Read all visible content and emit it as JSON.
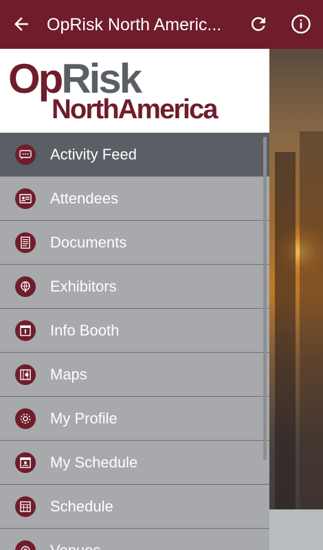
{
  "appbar": {
    "title": "OpRisk North Americ..."
  },
  "logo": {
    "op": "Op",
    "risk": "Risk",
    "line2": "NorthAmerica"
  },
  "menu": [
    {
      "label": "Activity Feed",
      "icon": "chat-bubble-icon",
      "active": true
    },
    {
      "label": "Attendees",
      "icon": "id-card-icon"
    },
    {
      "label": "Documents",
      "icon": "document-icon"
    },
    {
      "label": "Exhibitors",
      "icon": "globe-icon"
    },
    {
      "label": "Info Booth",
      "icon": "info-booth-icon"
    },
    {
      "label": "Maps",
      "icon": "map-icon"
    },
    {
      "label": "My Profile",
      "icon": "gear-icon"
    },
    {
      "label": "My Schedule",
      "icon": "calendar-person-icon"
    },
    {
      "label": "Schedule",
      "icon": "calendar-grid-icon"
    },
    {
      "label": "Venues",
      "icon": "venue-icon"
    }
  ],
  "colors": {
    "brand": "#6f1d2b",
    "gray": "#5a5f66",
    "drawer": "#a7a9ac"
  }
}
